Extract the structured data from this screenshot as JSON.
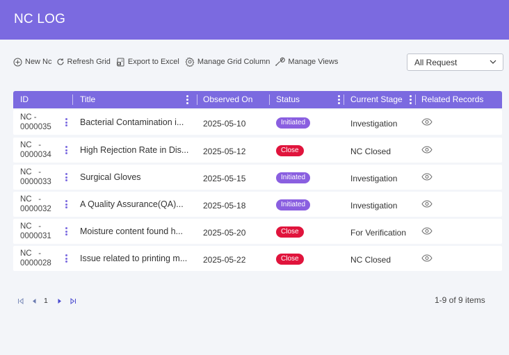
{
  "header": {
    "title": "NC LOG"
  },
  "toolbar": {
    "new_nc": "New Nc",
    "refresh": "Refresh Grid",
    "export": "Export to Excel",
    "manage_columns": "Manage Grid Column",
    "manage_views": "Manage Views"
  },
  "filter": {
    "selected": "All Request"
  },
  "grid": {
    "columns": {
      "id": "ID",
      "title": "Title",
      "observed_on": "Observed On",
      "status": "Status",
      "current_stage": "Current Stage",
      "related_records": "Related Records"
    },
    "rows": [
      {
        "id_prefix": "NC -",
        "id_num": "0000035",
        "title": "Bacterial Contamination i...",
        "observed_on": "2025-05-10",
        "status": "Initiated",
        "stage": "Investigation"
      },
      {
        "id_prefix": "NC   -",
        "id_num": "0000034",
        "title": "High Rejection Rate in Dis...",
        "observed_on": "2025-05-12",
        "status": "Close",
        "stage": "NC Closed"
      },
      {
        "id_prefix": "NC   -",
        "id_num": "0000033",
        "title": "Surgical Gloves",
        "observed_on": "2025-05-15",
        "status": "Initiated",
        "stage": "Investigation"
      },
      {
        "id_prefix": "NC   -",
        "id_num": "0000032",
        "title": "A Quality Assurance(QA)...",
        "observed_on": "2025-05-18",
        "status": "Initiated",
        "stage": "Investigation"
      },
      {
        "id_prefix": "NC   -",
        "id_num": "0000031",
        "title": "Moisture content found h...",
        "observed_on": "2025-05-20",
        "status": "Close",
        "stage": "For Verification"
      },
      {
        "id_prefix": "NC   -",
        "id_num": "0000028",
        "title": "Issue related to printing m...",
        "observed_on": "2025-05-22",
        "status": "Close",
        "stage": "NC Closed"
      }
    ]
  },
  "pager": {
    "current_page": "1",
    "summary": "1-9 of 9 items"
  },
  "colors": {
    "accent": "#7b6ae0",
    "initiated": "#8a5fe0",
    "close": "#e0143c"
  },
  "icons": [
    "plus-circle-icon",
    "refresh-icon",
    "excel-icon",
    "gear-icon",
    "wrench-icon",
    "chevron-down-icon",
    "kebab-icon",
    "eye-icon",
    "first-page-icon",
    "prev-page-icon",
    "next-page-icon",
    "last-page-icon"
  ]
}
